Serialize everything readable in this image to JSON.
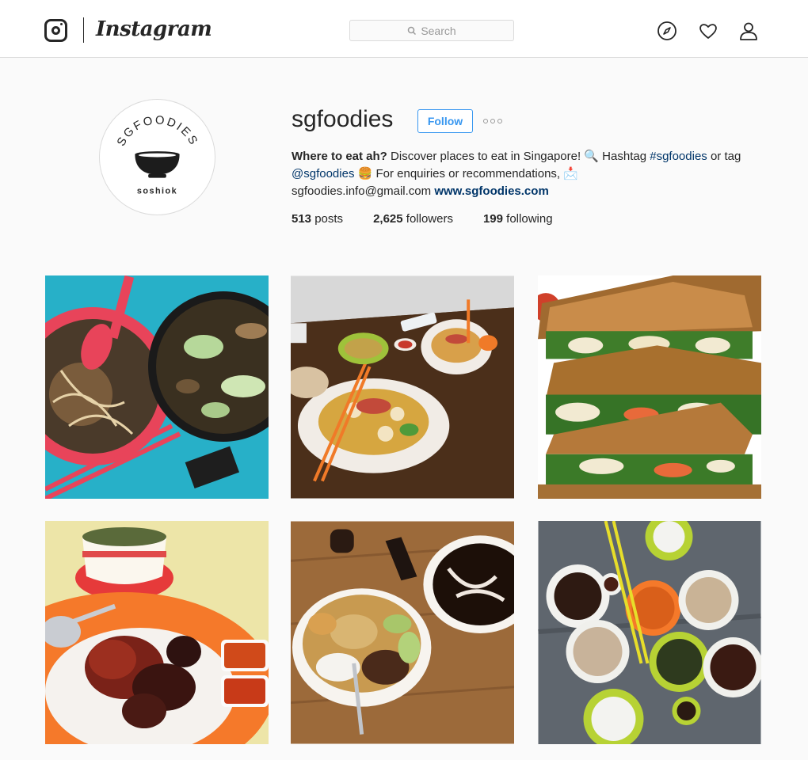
{
  "header": {
    "wordmark": "Instagram",
    "search_placeholder": "Search"
  },
  "profile": {
    "username": "sgfoodies",
    "follow_label": "Follow",
    "avatar": {
      "ring_text": "SGFOODIES",
      "tagline": "soshiok"
    },
    "bio": {
      "lead_bold": "Where to eat ah?",
      "line1_text": " Discover places to eat in Singapore! ",
      "magnifier_emoji": "🔍",
      "hashtag_prefix": " Hashtag ",
      "hashtag": "#sgfoodies",
      "or_tag": " or tag ",
      "mention": "@sgfoodies",
      "burger_emoji": "🍔",
      "enquiries": " For enquiries or recommendations, ",
      "mail_emoji": "📩",
      "email": "sgfoodies.info@gmail.com",
      "website": "www.sgfoodies.com"
    },
    "stats": {
      "posts_count": "513",
      "posts_label": "posts",
      "followers_count": "2,625",
      "followers_label": "followers",
      "following_count": "199",
      "following_label": "following"
    }
  },
  "posts": [
    {
      "name": "post-noodle-soup-and-vegetables"
    },
    {
      "name": "post-wanton-mee"
    },
    {
      "name": "post-grilled-sandwich-stack"
    },
    {
      "name": "post-roast-duck-rice"
    },
    {
      "name": "post-mixed-rice-and-cendol"
    },
    {
      "name": "post-bak-kut-teh-spread"
    }
  ],
  "colors": {
    "accent": "#3897f0",
    "link": "#003569",
    "border": "#dbdbdb"
  }
}
